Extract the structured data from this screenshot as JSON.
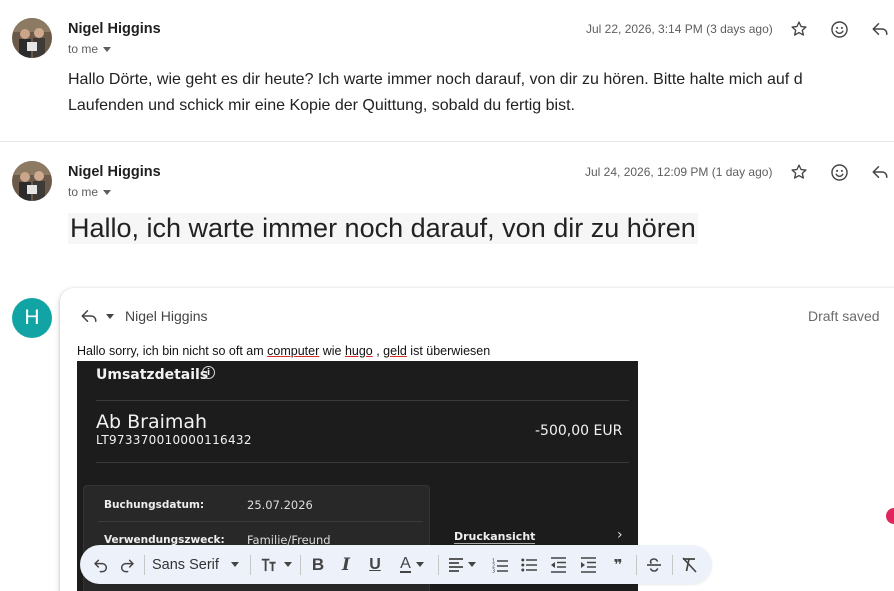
{
  "messages": [
    {
      "sender": "Nigel Higgins",
      "to_label": "to me",
      "date": "Jul 22, 2026, 3:14 PM (3 days ago)",
      "body_line1": "Hallo Dörte, wie geht es dir heute? Ich warte immer noch darauf, von dir zu hören. Bitte halte mich auf d",
      "body_line2": "Laufenden und schick mir eine Kopie der Quittung, sobald du fertig bist."
    },
    {
      "sender": "Nigel Higgins",
      "to_label": "to me",
      "date": "Jul 24, 2026, 12:09 PM (1 day ago)",
      "body": "Hallo, ich warte immer noch darauf, von dir zu hören"
    }
  ],
  "composer": {
    "avatar_letter": "H",
    "reply_to": "Nigel Higgins",
    "status": "Draft saved",
    "text_parts": [
      "Hallo sorry, ich bin nicht so oft am ",
      "computer",
      " wie ",
      "hugo",
      " , ",
      "geld",
      " ist überwiesen"
    ]
  },
  "receipt": {
    "title": "Umsatzdetails",
    "info_glyph": "i",
    "name": "Ab Braimah",
    "iban": "LT973370010000116432",
    "amount": "-500,00 EUR",
    "rows": [
      {
        "label": "Buchungsdatum:",
        "value": "25.07.2026"
      },
      {
        "label": "Verwendungszweck:",
        "value": "Familie/Freund"
      }
    ],
    "print_label": "Druckansicht",
    "chevron": "›"
  },
  "toolbar": {
    "font": "Sans Serif",
    "buttons": [
      "undo",
      "redo",
      "font-size",
      "bold",
      "italic",
      "underline",
      "text-color",
      "align",
      "numbered-list",
      "bulleted-list",
      "indent-less",
      "indent-more",
      "quote",
      "strikethrough",
      "remove-formatting"
    ]
  },
  "colors": {
    "accent_avatar": "#12a4a4",
    "notification_dot": "#e0245e",
    "receipt_bg": "#1c1c1c",
    "toolbar_bg": "#edf1f9"
  }
}
